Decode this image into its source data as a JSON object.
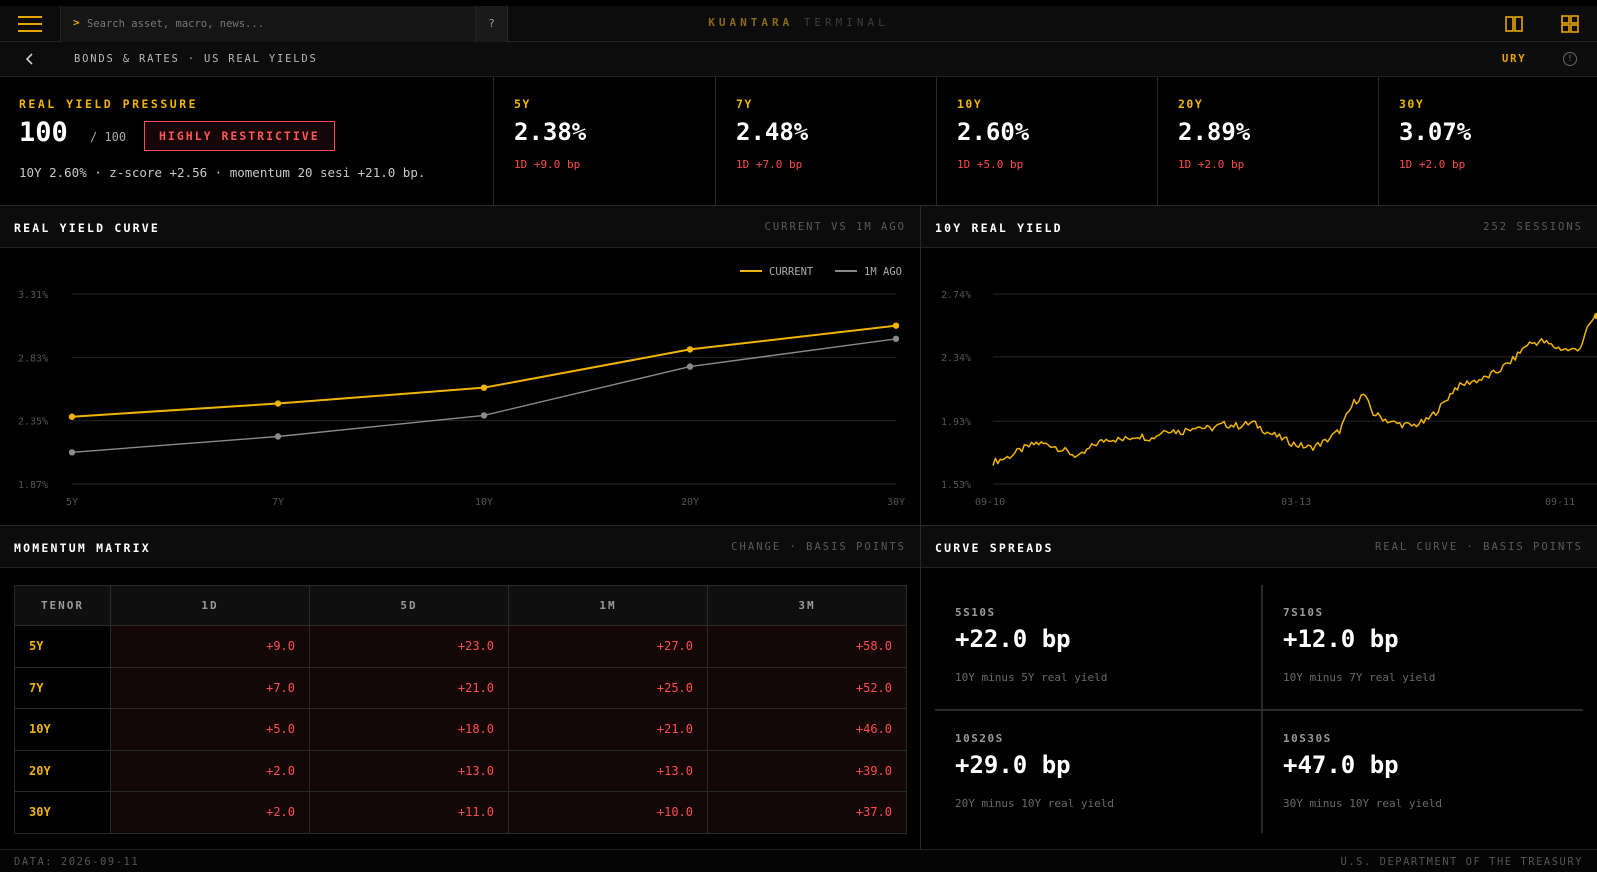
{
  "app": {
    "brand_primary": "KUANTARA",
    "brand_secondary": "TERMINAL",
    "accent_color": "#f0b400",
    "negative_color": "#ff4d4d"
  },
  "topbar": {
    "menu_icon": "hamburger-menu-icon",
    "search_prompt": ">",
    "search_placeholder": "Search asset, macro, news...",
    "help_label": "?",
    "layout_icons": [
      "split-view-icon",
      "grid-view-icon"
    ]
  },
  "breadcrumb": {
    "back_icon": "chevron-left-icon",
    "path": "BONDS & RATES · US REAL YIELDS",
    "ticker": "URY",
    "info_label": "!"
  },
  "pressure": {
    "label": "REAL YIELD PRESSURE",
    "value": "100",
    "denominator": "/ 100",
    "badge": "HIGHLY RESTRICTIVE",
    "detail": "10Y 2.60% · z-score +2.56 · momentum 20 sesi +21.0 bp."
  },
  "tenors": [
    {
      "label": "5Y",
      "value": "2.38%",
      "change": "1D +9.0 bp"
    },
    {
      "label": "7Y",
      "value": "2.48%",
      "change": "1D +7.0 bp"
    },
    {
      "label": "10Y",
      "value": "2.60%",
      "change": "1D +5.0 bp"
    },
    {
      "label": "20Y",
      "value": "2.89%",
      "change": "1D +2.0 bp"
    },
    {
      "label": "30Y",
      "value": "3.07%",
      "change": "1D +2.0 bp"
    }
  ],
  "curve_panel": {
    "title": "REAL YIELD CURVE",
    "subtitle": "CURRENT VS 1M AGO"
  },
  "history_panel": {
    "title": "10Y REAL YIELD",
    "subtitle": "252 SESSIONS"
  },
  "momentum_panel": {
    "title": "MOMENTUM MATRIX",
    "subtitle": "CHANGE · BASIS POINTS",
    "headers": [
      "TENOR",
      "1D",
      "5D",
      "1M",
      "3M"
    ],
    "rows": [
      {
        "tenor": "5Y",
        "values": [
          "+9.0",
          "+23.0",
          "+27.0",
          "+58.0"
        ]
      },
      {
        "tenor": "7Y",
        "values": [
          "+7.0",
          "+21.0",
          "+25.0",
          "+52.0"
        ]
      },
      {
        "tenor": "10Y",
        "values": [
          "+5.0",
          "+18.0",
          "+21.0",
          "+46.0"
        ]
      },
      {
        "tenor": "20Y",
        "values": [
          "+2.0",
          "+13.0",
          "+13.0",
          "+39.0"
        ]
      },
      {
        "tenor": "30Y",
        "values": [
          "+2.0",
          "+11.0",
          "+10.0",
          "+37.0"
        ]
      }
    ]
  },
  "spreads_panel": {
    "title": "CURVE SPREADS",
    "subtitle": "REAL CURVE · BASIS POINTS",
    "items": [
      {
        "label": "5S10S",
        "value": "+22.0 bp",
        "desc": "10Y minus 5Y real yield"
      },
      {
        "label": "7S10S",
        "value": "+12.0 bp",
        "desc": "10Y minus 7Y real yield"
      },
      {
        "label": "10S20S",
        "value": "+29.0 bp",
        "desc": "20Y minus 10Y real yield"
      },
      {
        "label": "10S30S",
        "value": "+47.0 bp",
        "desc": "30Y minus 10Y real yield"
      }
    ]
  },
  "footer": {
    "left": "DATA: 2026-09-11",
    "right": "U.S. DEPARTMENT OF THE TREASURY"
  },
  "chart_data": [
    {
      "type": "line",
      "categories": [
        "5Y",
        "7Y",
        "10Y",
        "20Y",
        "30Y"
      ],
      "series": [
        {
          "name": "CURRENT",
          "values": [
            2.38,
            2.48,
            2.6,
            2.89,
            3.07
          ],
          "color": "#f0b400"
        },
        {
          "name": "1M AGO",
          "values": [
            2.11,
            2.23,
            2.39,
            2.76,
            2.97
          ],
          "color": "#8a8a8a"
        }
      ],
      "yticks": [
        "3.31%",
        "2.83%",
        "2.35%",
        "1.87%"
      ],
      "ylim": [
        1.87,
        3.31
      ],
      "legend": "top-right",
      "grid": true
    },
    {
      "type": "line",
      "xticks": [
        "09-10",
        "03-13",
        "09-11"
      ],
      "yticks": [
        "2.74%",
        "2.34%",
        "1.93%"
      ],
      "ylim": [
        1.53,
        2.74
      ],
      "sessions": 252,
      "anchors": [
        [
          0,
          1.67
        ],
        [
          6,
          1.7
        ],
        [
          12,
          1.75
        ],
        [
          18,
          1.79
        ],
        [
          24,
          1.78
        ],
        [
          30,
          1.74
        ],
        [
          36,
          1.7
        ],
        [
          42,
          1.78
        ],
        [
          48,
          1.82
        ],
        [
          54,
          1.81
        ],
        [
          60,
          1.84
        ],
        [
          66,
          1.82
        ],
        [
          72,
          1.88
        ],
        [
          78,
          1.86
        ],
        [
          84,
          1.9
        ],
        [
          90,
          1.88
        ],
        [
          96,
          1.91
        ],
        [
          102,
          1.9
        ],
        [
          108,
          1.92
        ],
        [
          114,
          1.86
        ],
        [
          120,
          1.82
        ],
        [
          126,
          1.78
        ],
        [
          132,
          1.76
        ],
        [
          138,
          1.8
        ],
        [
          144,
          1.87
        ],
        [
          150,
          2.05
        ],
        [
          154,
          2.1
        ],
        [
          158,
          1.98
        ],
        [
          166,
          1.92
        ],
        [
          174,
          1.9
        ],
        [
          180,
          1.93
        ],
        [
          186,
          2.02
        ],
        [
          192,
          2.14
        ],
        [
          198,
          2.18
        ],
        [
          204,
          2.2
        ],
        [
          210,
          2.25
        ],
        [
          216,
          2.32
        ],
        [
          222,
          2.42
        ],
        [
          228,
          2.44
        ],
        [
          234,
          2.4
        ],
        [
          240,
          2.38
        ],
        [
          244,
          2.4
        ],
        [
          248,
          2.55
        ],
        [
          251,
          2.6
        ]
      ],
      "last_value": 2.6,
      "color": "#f0b400",
      "grid": true
    }
  ]
}
